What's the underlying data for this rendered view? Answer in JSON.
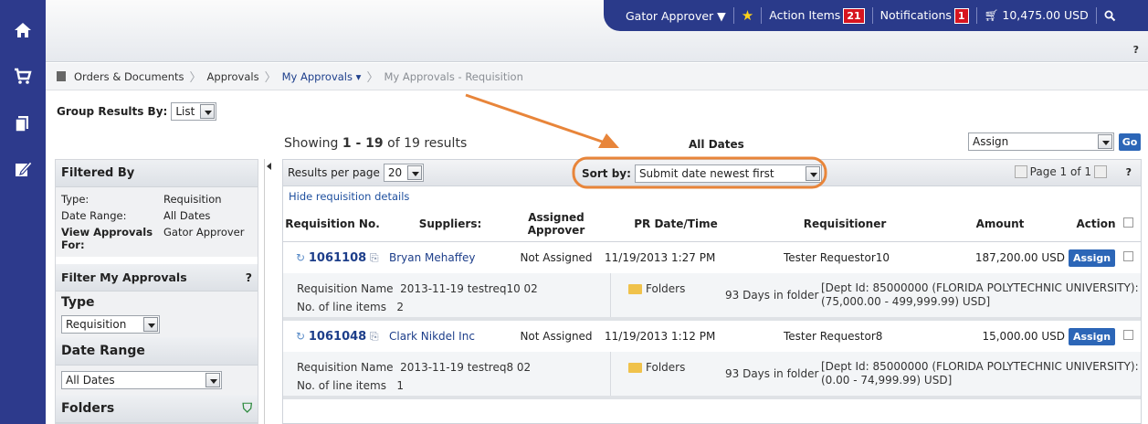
{
  "header": {
    "user": "Gator Approver",
    "action_items_label": "Action Items",
    "action_items_count": "21",
    "notifications_label": "Notifications",
    "notifications_count": "1",
    "cart_total": "10,475.00 USD",
    "help": "?"
  },
  "breadcrumb": [
    "Orders & Documents",
    "Approvals",
    "My Approvals",
    "My Approvals - Requisition"
  ],
  "group": {
    "label": "Group Results By:",
    "value": "List"
  },
  "results": {
    "showing_prefix": "Showing ",
    "showing_range": "1 - 19",
    "showing_suffix": " of 19 results",
    "date_filter": "All Dates",
    "bulk_action": "Assign",
    "go": "Go",
    "per_page_label": "Results per page",
    "per_page": "20",
    "sort_label": "Sort by:",
    "sort_value": "Submit date newest first",
    "page_label": "Page 1 of 1",
    "help": "?",
    "hide_details": "Hide requisition details"
  },
  "columns": [
    "Requisition No.",
    "Suppliers:",
    "Assigned Approver",
    "PR Date/Time",
    "Requisitioner",
    "Amount",
    "Action"
  ],
  "rows": [
    {
      "req_no": "1061108",
      "supplier": "Bryan Mehaffey",
      "approver": "Not Assigned",
      "date": "11/19/2013 1:27 PM",
      "requisitioner": "Tester Requestor10",
      "amount": "187,200.00 USD",
      "action": "Assign",
      "req_name_label": "Requisition Name",
      "req_name": "2013-11-19 testreq10 02",
      "lines_label": "No. of line items",
      "lines": "2",
      "folders": "Folders",
      "days": "93 Days in folder",
      "dept_line1": "[Dept Id: 85000000 (FLORIDA POLYTECHNIC UNIVERSITY):",
      "dept_line2": "(75,000.00 - 499,999.99) USD]"
    },
    {
      "req_no": "1061048",
      "supplier": "Clark Nikdel Inc",
      "approver": "Not Assigned",
      "date": "11/19/2013 1:12 PM",
      "requisitioner": "Tester Requestor8",
      "amount": "15,000.00 USD",
      "action": "Assign",
      "req_name_label": "Requisition Name",
      "req_name": "2013-11-19 testreq8 02",
      "lines_label": "No. of line items",
      "lines": "1",
      "folders": "Folders",
      "days": "93 Days in folder",
      "dept_line1": "[Dept Id: 85000000 (FLORIDA POLYTECHNIC UNIVERSITY):",
      "dept_line2": "(0.00 - 74,999.99) USD]"
    }
  ],
  "filters": {
    "title": "Filtered By",
    "type_label": "Type:",
    "type_value": "Requisition",
    "range_label": "Date Range:",
    "range_value": "All Dates",
    "view_label": "View Approvals For:",
    "view_value": "Gator Approver",
    "my_title": "Filter My Approvals",
    "help": "?",
    "type_heading": "Type",
    "type_select": "Requisition",
    "range_heading": "Date Range",
    "range_select": "All Dates",
    "folders_heading": "Folders"
  },
  "colors": {
    "nav": "#2d3a8c",
    "accent": "#2c66b7",
    "annotation": "#e8853a",
    "badge": "#d7141f"
  }
}
